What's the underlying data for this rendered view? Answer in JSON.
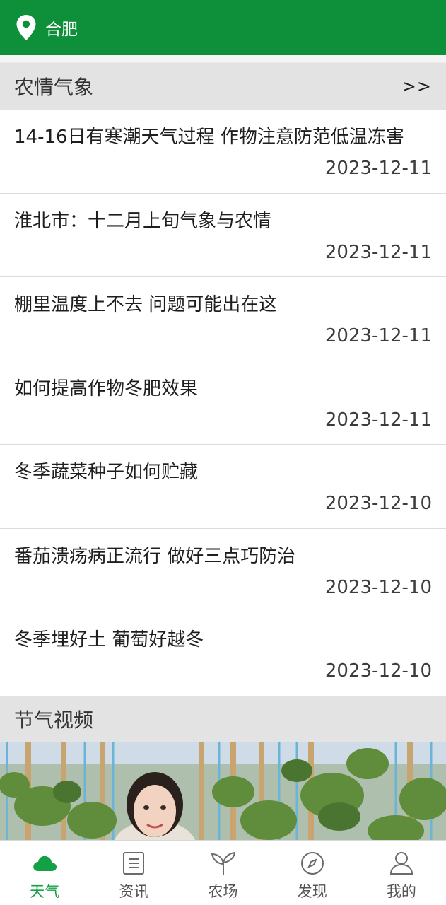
{
  "header": {
    "city": "合肥"
  },
  "weather_section": {
    "title": "农情气象",
    "more": ">>"
  },
  "news": [
    {
      "title": "14-16日有寒潮天气过程  作物注意防范低温冻害",
      "date": "2023-12-11"
    },
    {
      "title": "淮北市：十二月上旬气象与农情",
      "date": "2023-12-11"
    },
    {
      "title": "棚里温度上不去 问题可能出在这",
      "date": "2023-12-11"
    },
    {
      "title": "如何提高作物冬肥效果",
      "date": "2023-12-11"
    },
    {
      "title": "冬季蔬菜种子如何贮藏",
      "date": "2023-12-10"
    },
    {
      "title": "番茄溃疡病正流行 做好三点巧防治",
      "date": "2023-12-10"
    },
    {
      "title": "冬季埋好土  葡萄好越冬",
      "date": "2023-12-10"
    }
  ],
  "video_section": {
    "title": "节气视频"
  },
  "tabs": [
    {
      "label": "天气",
      "icon": "cloud-icon",
      "active": true
    },
    {
      "label": "资讯",
      "icon": "news-icon",
      "active": false
    },
    {
      "label": "农场",
      "icon": "sprout-icon",
      "active": false
    },
    {
      "label": "发现",
      "icon": "compass-icon",
      "active": false
    },
    {
      "label": "我的",
      "icon": "user-icon",
      "active": false
    }
  ],
  "colors": {
    "brand": "#0e8f3a",
    "active_tab": "#14a045"
  }
}
